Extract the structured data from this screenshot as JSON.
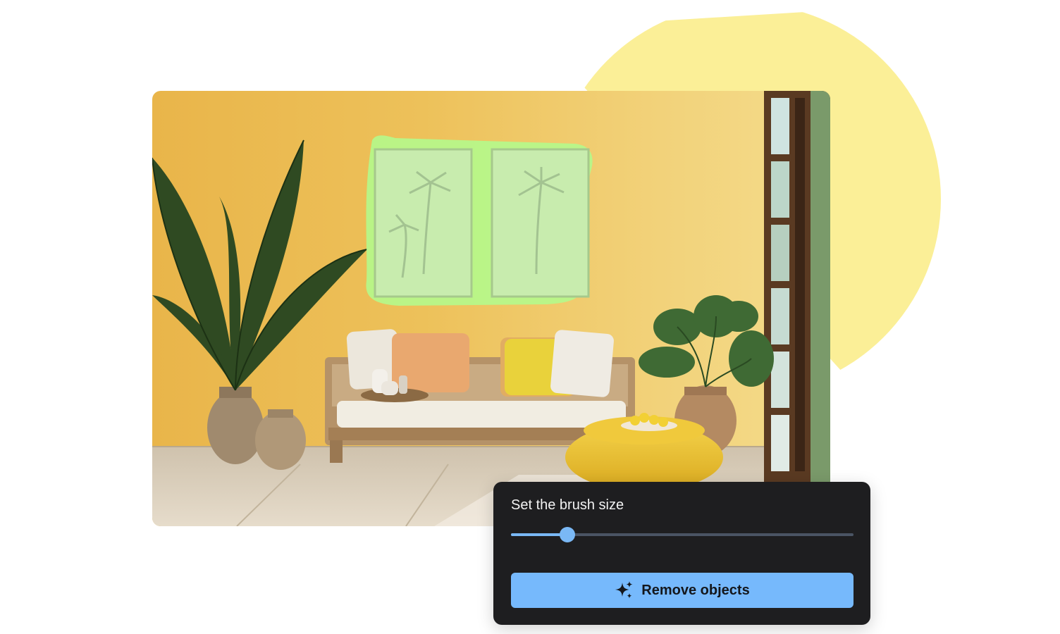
{
  "brush_panel": {
    "title": "Set the brush size",
    "brush_size_fraction": 0.165,
    "remove_button_label": "Remove objects",
    "remove_button_icon": "sparkle-icon"
  },
  "colors": {
    "accent": "#76b9fc",
    "panel_background": "#1e1e20",
    "selection_mask": "#b4fa8c",
    "decor_circle": "#fbef97"
  }
}
